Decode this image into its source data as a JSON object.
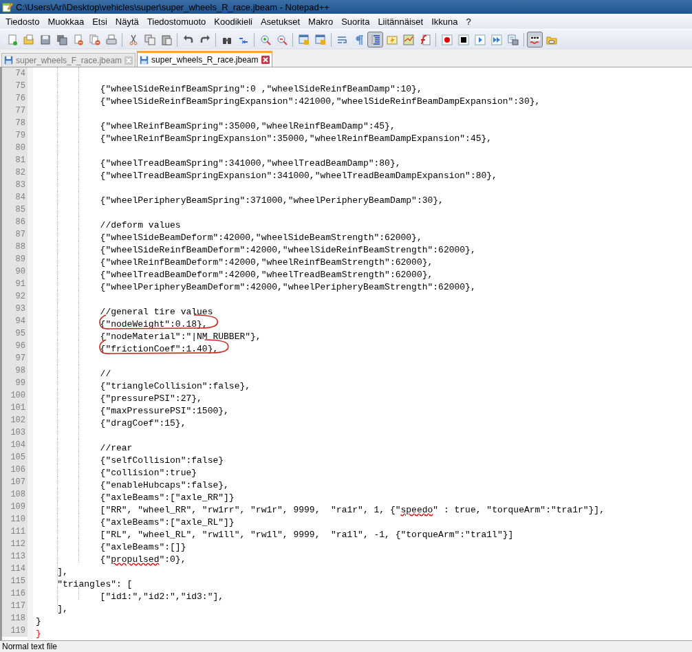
{
  "window": {
    "title": "C:\\Users\\Ari\\Desktop\\vehicles\\super\\super_wheels_R_race.jbeam - Notepad++"
  },
  "menu": [
    "Tiedosto",
    "Muokkaa",
    "Etsi",
    "Näytä",
    "Tiedostomuoto",
    "Koodikieli",
    "Asetukset",
    "Makro",
    "Suorita",
    "Liitännäiset",
    "Ikkuna",
    "?"
  ],
  "toolbar": [
    {
      "kind": "new",
      "pressed": false
    },
    {
      "kind": "open",
      "pressed": false
    },
    {
      "kind": "save",
      "pressed": false
    },
    {
      "kind": "saveall",
      "pressed": false
    },
    {
      "kind": "close",
      "pressed": false
    },
    {
      "kind": "closeall",
      "pressed": false
    },
    {
      "kind": "print",
      "pressed": false
    },
    {
      "kind": "separator"
    },
    {
      "kind": "cut",
      "pressed": false
    },
    {
      "kind": "copy",
      "pressed": false
    },
    {
      "kind": "paste",
      "pressed": false
    },
    {
      "kind": "separator"
    },
    {
      "kind": "undo",
      "pressed": false
    },
    {
      "kind": "redo",
      "pressed": false
    },
    {
      "kind": "separator"
    },
    {
      "kind": "find",
      "pressed": false
    },
    {
      "kind": "replace",
      "pressed": false
    },
    {
      "kind": "separator"
    },
    {
      "kind": "zoomin",
      "pressed": false
    },
    {
      "kind": "zoomout",
      "pressed": false
    },
    {
      "kind": "separator"
    },
    {
      "kind": "syncv",
      "pressed": false
    },
    {
      "kind": "synch",
      "pressed": false
    },
    {
      "kind": "separator"
    },
    {
      "kind": "wrap",
      "pressed": false
    },
    {
      "kind": "pilcrow",
      "pressed": false
    },
    {
      "kind": "indent",
      "pressed": true
    },
    {
      "kind": "udl",
      "pressed": false
    },
    {
      "kind": "map",
      "pressed": false
    },
    {
      "kind": "function",
      "pressed": false
    },
    {
      "kind": "separator"
    },
    {
      "kind": "record",
      "pressed": false
    },
    {
      "kind": "stop",
      "pressed": false
    },
    {
      "kind": "play",
      "pressed": false
    },
    {
      "kind": "playmulti",
      "pressed": false
    },
    {
      "kind": "savemacro",
      "pressed": false
    },
    {
      "kind": "separator"
    },
    {
      "kind": "spellcheck",
      "pressed": true
    },
    {
      "kind": "folder",
      "pressed": false
    }
  ],
  "tabs": [
    {
      "label": "super_wheels_F_race.jbeam",
      "selected": false
    },
    {
      "label": "super_wheels_R_race.jbeam",
      "selected": true
    }
  ],
  "lines": [
    {
      "number": "74",
      "circled": false
    },
    {
      "number": "75",
      "circled": false,
      "segments": [
        {
          "text": "            {\"wheelSideReinfBeamSpring\":0 ,\"wheelSideReinfBeamDamp\":10},",
          "kind": "plain"
        }
      ]
    },
    {
      "number": "76",
      "circled": false,
      "segments": [
        {
          "text": "            {\"wheelSideReinfBeamSpringExpansion\":421000,\"wheelSideReinfBeamDampExpansion\":30},",
          "kind": "plain"
        }
      ]
    },
    {
      "number": "77",
      "circled": false
    },
    {
      "number": "78",
      "circled": false,
      "segments": [
        {
          "text": "            {\"wheelReinfBeamSpring\":35000,\"wheelReinfBeamDamp\":45},",
          "kind": "plain"
        }
      ]
    },
    {
      "number": "79",
      "circled": false,
      "segments": [
        {
          "text": "            {\"wheelReinfBeamSpringExpansion\":35000,\"wheelReinfBeamDampExpansion\":45},",
          "kind": "plain"
        }
      ]
    },
    {
      "number": "80",
      "circled": false
    },
    {
      "number": "81",
      "circled": false,
      "segments": [
        {
          "text": "            {\"wheelTreadBeamSpring\":341000,\"wheelTreadBeamDamp\":80},",
          "kind": "plain"
        }
      ]
    },
    {
      "number": "82",
      "circled": false,
      "segments": [
        {
          "text": "            {\"wheelTreadBeamSpringExpansion\":341000,\"wheelTreadBeamDampExpansion\":80},",
          "kind": "plain"
        }
      ]
    },
    {
      "number": "83",
      "circled": false
    },
    {
      "number": "84",
      "circled": false,
      "segments": [
        {
          "text": "            {\"wheelPeripheryBeamSpring\":371000,\"wheelPeripheryBeamDamp\":30},",
          "kind": "plain"
        }
      ]
    },
    {
      "number": "85",
      "circled": false
    },
    {
      "number": "86",
      "circled": false,
      "segments": [
        {
          "text": "            //deform values",
          "kind": "plain"
        }
      ]
    },
    {
      "number": "87",
      "circled": false,
      "segments": [
        {
          "text": "            {\"wheelSideBeamDeform\":42000,\"wheelSideBeamStrength\":62000},",
          "kind": "plain"
        }
      ]
    },
    {
      "number": "88",
      "circled": false,
      "segments": [
        {
          "text": "            {\"wheelSideReinfBeamDeform\":42000,\"wheelSideReinfBeamStrength\":62000},",
          "kind": "plain"
        }
      ]
    },
    {
      "number": "89",
      "circled": false,
      "segments": [
        {
          "text": "            {\"wheelReinfBeamDeform\":42000,\"wheelReinfBeamStrength\":62000},",
          "kind": "plain"
        }
      ]
    },
    {
      "number": "90",
      "circled": false,
      "segments": [
        {
          "text": "            {\"wheelTreadBeamDeform\":42000,\"wheelTreadBeamStrength\":62000},",
          "kind": "plain"
        }
      ]
    },
    {
      "number": "91",
      "circled": false,
      "segments": [
        {
          "text": "            {\"wheelPeripheryBeamDeform\":42000,\"wheelPeripheryBeamStrength\":62000},",
          "kind": "plain"
        }
      ]
    },
    {
      "number": "92",
      "circled": false
    },
    {
      "number": "93",
      "circled": false,
      "segments": [
        {
          "text": "            //general tire values",
          "kind": "plain"
        }
      ]
    },
    {
      "number": "94",
      "circled": true,
      "segments": [
        {
          "text": "            {\"nodeWeight\":0.18},",
          "kind": "plain"
        }
      ]
    },
    {
      "number": "95",
      "circled": false,
      "segments": [
        {
          "text": "            {\"nodeMaterial\":\"|NM_RUBBER\"},",
          "kind": "plain"
        }
      ]
    },
    {
      "number": "96",
      "circled": true,
      "segments": [
        {
          "text": "            {\"frictionCoef\":1.40},",
          "kind": "plain"
        }
      ]
    },
    {
      "number": "97",
      "circled": false
    },
    {
      "number": "98",
      "circled": false,
      "segments": [
        {
          "text": "            //",
          "kind": "plain"
        }
      ]
    },
    {
      "number": "99",
      "circled": false,
      "segments": [
        {
          "text": "            {\"triangleCollision\":false},",
          "kind": "plain"
        }
      ]
    },
    {
      "number": "100",
      "circled": false,
      "segments": [
        {
          "text": "            {\"pressurePSI\":27},",
          "kind": "plain"
        }
      ]
    },
    {
      "number": "101",
      "circled": false,
      "segments": [
        {
          "text": "            {\"maxPressurePSI\":1500},",
          "kind": "plain"
        }
      ]
    },
    {
      "number": "102",
      "circled": false,
      "segments": [
        {
          "text": "            {\"dragCoef\":15},",
          "kind": "plain"
        }
      ]
    },
    {
      "number": "103",
      "circled": false
    },
    {
      "number": "104",
      "circled": false,
      "segments": [
        {
          "text": "            //rear",
          "kind": "plain"
        }
      ]
    },
    {
      "number": "105",
      "circled": false,
      "segments": [
        {
          "text": "            {\"selfCollision\":false}",
          "kind": "plain"
        }
      ]
    },
    {
      "number": "106",
      "circled": false,
      "segments": [
        {
          "text": "            {\"collision\":true}",
          "kind": "plain"
        }
      ]
    },
    {
      "number": "107",
      "circled": false,
      "segments": [
        {
          "text": "            {\"enableHubcaps\":false},",
          "kind": "plain"
        }
      ]
    },
    {
      "number": "108",
      "circled": false,
      "segments": [
        {
          "text": "            {\"axleBeams\":[\"axle_RR\"]}",
          "kind": "plain"
        }
      ]
    },
    {
      "number": "109",
      "circled": false,
      "segments": [
        {
          "text": "            [\"RR\", \"wheel_RR\", \"rw1rr\", \"rw1r\", 9999,  \"ra1r\", 1, {\"",
          "kind": "plain"
        },
        {
          "text": "speedo",
          "kind": "misspelled"
        },
        {
          "text": "\" : true, \"torqueArm\":\"tra1r\"}],",
          "kind": "plain"
        }
      ]
    },
    {
      "number": "110",
      "circled": false,
      "segments": [
        {
          "text": "            {\"axleBeams\":[\"axle_RL\"]}",
          "kind": "plain"
        }
      ]
    },
    {
      "number": "111",
      "circled": false,
      "segments": [
        {
          "text": "            [\"RL\", \"wheel_RL\", \"rw1ll\", \"rw1l\", 9999,  \"ra1l\", -1, {\"torqueArm\":\"tra1l\"}]",
          "kind": "plain"
        }
      ]
    },
    {
      "number": "112",
      "circled": false,
      "segments": [
        {
          "text": "            {\"axleBeams\":[]}",
          "kind": "plain"
        }
      ]
    },
    {
      "number": "113",
      "circled": false,
      "segments": [
        {
          "text": "            {\"",
          "kind": "plain"
        },
        {
          "text": "propulsed",
          "kind": "misspelled"
        },
        {
          "text": "\":0},",
          "kind": "plain"
        }
      ]
    },
    {
      "number": "114",
      "circled": false,
      "segments": [
        {
          "text": "    ],",
          "kind": "plain"
        }
      ]
    },
    {
      "number": "115",
      "circled": false,
      "segments": [
        {
          "text": "    \"triangles\": [",
          "kind": "plain"
        }
      ]
    },
    {
      "number": "116",
      "circled": false,
      "segments": [
        {
          "text": "            [\"id1:\",\"id2:\",\"id3:\"],",
          "kind": "plain"
        }
      ]
    },
    {
      "number": "117",
      "circled": false,
      "segments": [
        {
          "text": "    ],",
          "kind": "plain"
        }
      ]
    },
    {
      "number": "118",
      "circled": false,
      "segments": [
        {
          "text": "}",
          "kind": "plain"
        }
      ]
    },
    {
      "number": "119",
      "circled": false,
      "segments": [
        {
          "text": "}",
          "kind": "bracematch"
        }
      ]
    }
  ],
  "status_bar": {
    "file_type": "Normal text file"
  }
}
